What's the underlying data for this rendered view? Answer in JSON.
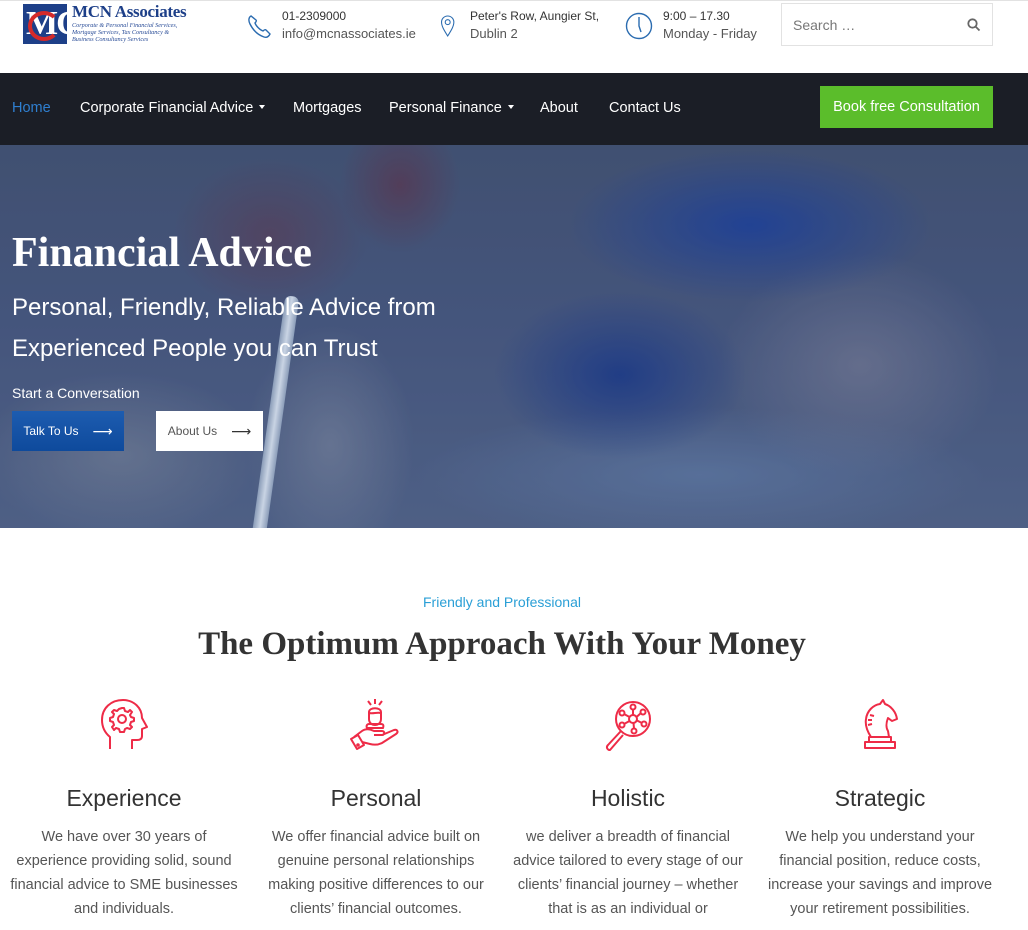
{
  "brand": {
    "name": "MCN Associates",
    "tagline": "Corporate & Personal Financial Services,\nMortgage Services, Tax Consultancy &\nBusiness Consultancy Services",
    "logo_letters": "MC",
    "colors": {
      "navy": "#1d3f88",
      "red": "#d42a2a"
    }
  },
  "contact": {
    "phone": {
      "icon": "phone-icon",
      "line1": "01-2309000",
      "line2": "info@mcnassociates.ie"
    },
    "address": {
      "icon": "map-pin-icon",
      "line1": "Peter's Row, Aungier St,",
      "line2": "Dublin 2"
    },
    "hours": {
      "icon": "clock-icon",
      "line1": "9:00 – 17.30",
      "line2": "Monday - Friday"
    }
  },
  "search": {
    "placeholder": "Search …",
    "value": "",
    "icon": "search-icon"
  },
  "nav": {
    "items": [
      {
        "label": "Home",
        "active": true,
        "dropdown": false
      },
      {
        "label": "Corporate Financial Advice",
        "active": false,
        "dropdown": true
      },
      {
        "label": "Mortgages",
        "active": false,
        "dropdown": false
      },
      {
        "label": "Personal Finance",
        "active": false,
        "dropdown": true
      },
      {
        "label": "About",
        "active": false,
        "dropdown": false
      },
      {
        "label": "Contact Us",
        "active": false,
        "dropdown": false
      }
    ],
    "cta": "Book free Consultation",
    "colors": {
      "background": "#1b1e26",
      "active": "#2f7fd0",
      "cta": "#5bbd2b"
    }
  },
  "hero": {
    "title": "Financial Advice",
    "subtitle": "Personal, Friendly, Reliable Advice from Experienced People you can Trust",
    "cta_label": "Start a Conversation",
    "primary_button": "Talk To Us",
    "secondary_button": "About Us",
    "arrow": "⟶",
    "colors": {
      "primary_button": "#0e4a9c"
    }
  },
  "features_section": {
    "eyebrow": "Friendly and Professional",
    "title": "The Optimum Approach With Your Money",
    "accent_color": "#ee2b47",
    "eyebrow_color": "#2a9fd6",
    "items": [
      {
        "icon": "head-gear-icon",
        "title": "Experience",
        "text": "We have over 30 years of experience providing solid, sound financial advice to SME businesses and individuals."
      },
      {
        "icon": "hand-person-icon",
        "title": "Personal",
        "text": "We offer financial advice built on genuine personal relationships making positive differences to our clients’ financial outcomes."
      },
      {
        "icon": "magnifier-network-icon",
        "title": "Holistic",
        "text": "we deliver a breadth of financial advice tailored to every stage of our clients’ financial journey – whether that is as an individual or"
      },
      {
        "icon": "chess-knight-icon",
        "title": "Strategic",
        "text": "We help you understand your financial position, reduce costs, increase your savings and improve your retirement possibilities."
      }
    ]
  }
}
